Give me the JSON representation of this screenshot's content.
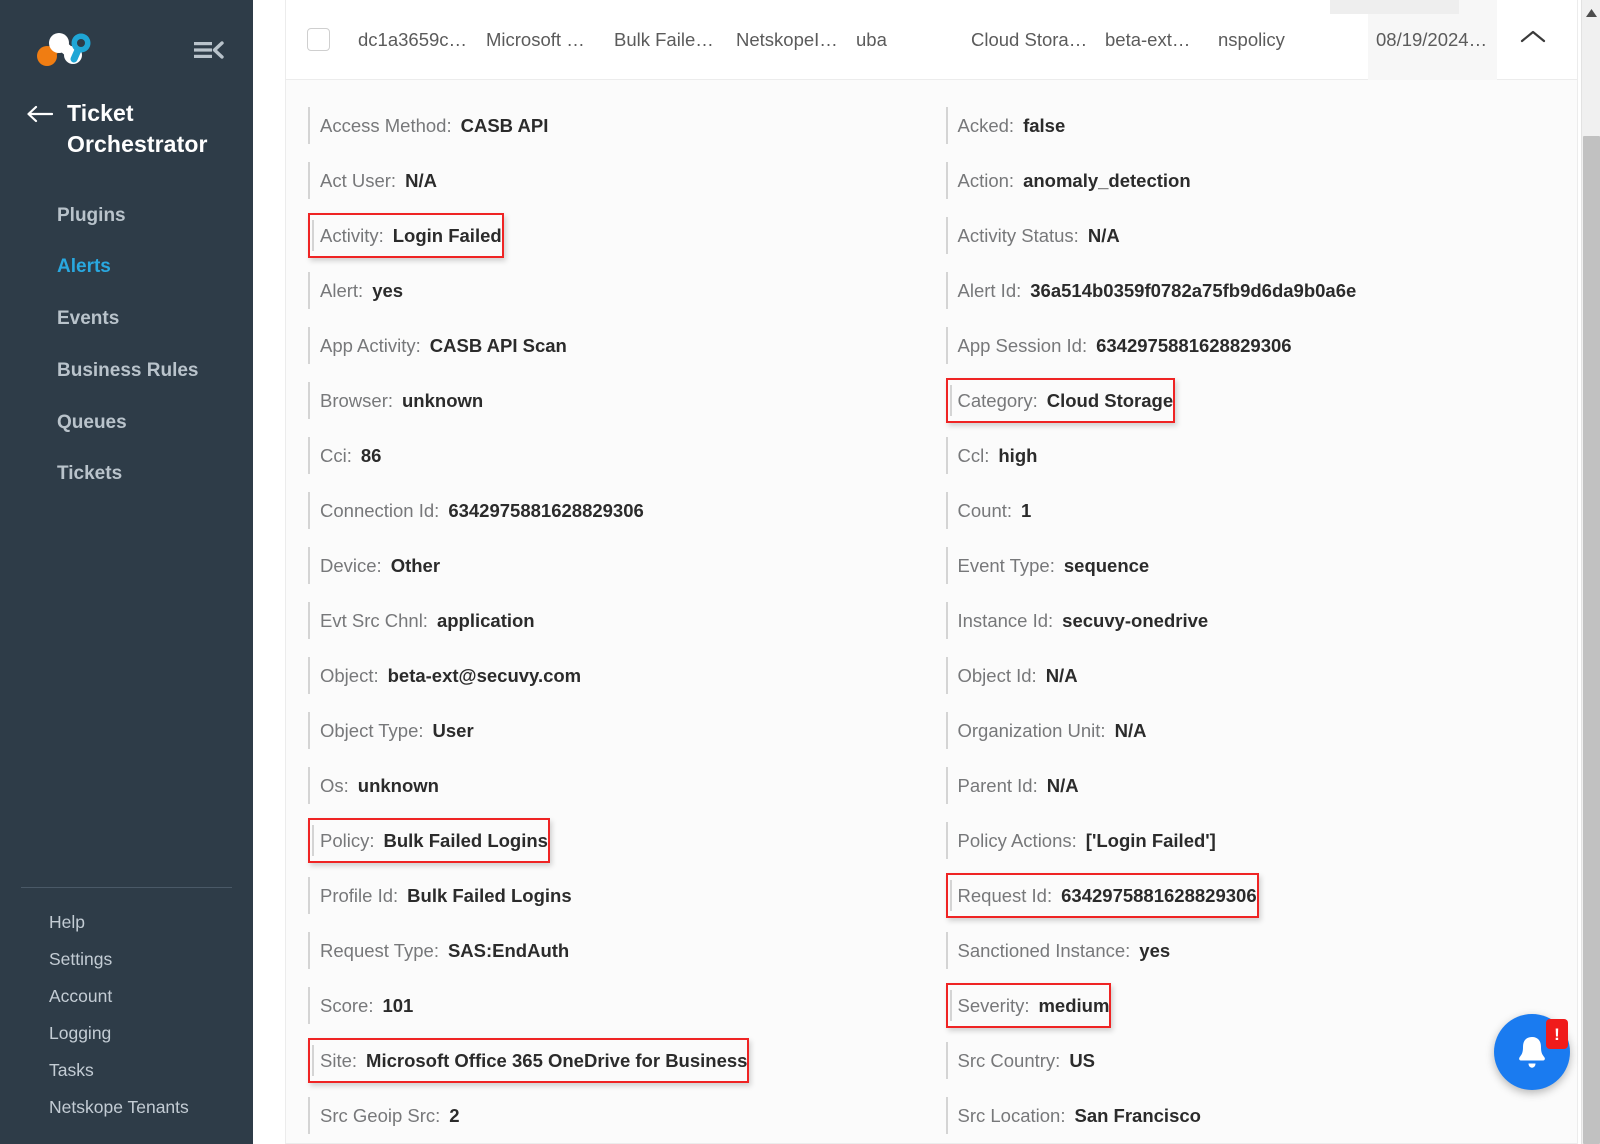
{
  "brand": {
    "logo_name": "secuvy-logo",
    "collapse_label": "collapse-sidebar"
  },
  "sidebar": {
    "title": "Ticket Orchestrator",
    "back_label": "back",
    "items": [
      {
        "label": "Plugins",
        "active": false
      },
      {
        "label": "Alerts",
        "active": true
      },
      {
        "label": "Events",
        "active": false
      },
      {
        "label": "Business Rules",
        "active": false
      },
      {
        "label": "Queues",
        "active": false
      },
      {
        "label": "Tickets",
        "active": false
      }
    ],
    "footer_items": [
      {
        "label": "Help"
      },
      {
        "label": "Settings"
      },
      {
        "label": "Account"
      },
      {
        "label": "Logging"
      },
      {
        "label": "Tasks"
      },
      {
        "label": "Netskope Tenants"
      }
    ]
  },
  "table_row": {
    "checkbox_checked": false,
    "cells": [
      {
        "text": "dc1a3659c7...",
        "sorted": false
      },
      {
        "text": "Microsoft Of...",
        "sorted": false
      },
      {
        "text": "Bulk Failed L...",
        "sorted": false
      },
      {
        "text": "NetskopeITS...",
        "sorted": false
      },
      {
        "text": "uba",
        "sorted": false
      },
      {
        "text": "Cloud Storage",
        "sorted": false
      },
      {
        "text": "beta-ext@se...",
        "sorted": false
      },
      {
        "text": "nspolicy",
        "sorted": false
      },
      {
        "text": "08/19/2024 ...",
        "sorted": true
      }
    ],
    "expand_icon": "chevron-up-icon"
  },
  "details": {
    "left": [
      {
        "label": "Access Method:",
        "value": "CASB API",
        "highlighted": false
      },
      {
        "label": "Act User:",
        "value": "N/A",
        "highlighted": false
      },
      {
        "label": "Activity:",
        "value": "Login Failed",
        "highlighted": true
      },
      {
        "label": "Alert:",
        "value": "yes",
        "highlighted": false
      },
      {
        "label": "App Activity:",
        "value": "CASB API Scan",
        "highlighted": false
      },
      {
        "label": "Browser:",
        "value": "unknown",
        "highlighted": false
      },
      {
        "label": "Cci:",
        "value": "86",
        "highlighted": false
      },
      {
        "label": "Connection Id:",
        "value": "6342975881628829306",
        "highlighted": false
      },
      {
        "label": "Device:",
        "value": "Other",
        "highlighted": false
      },
      {
        "label": "Evt Src Chnl:",
        "value": "application",
        "highlighted": false
      },
      {
        "label": "Object:",
        "value": "beta-ext@secuvy.com",
        "highlighted": false
      },
      {
        "label": "Object Type:",
        "value": "User",
        "highlighted": false
      },
      {
        "label": "Os:",
        "value": "unknown",
        "highlighted": false
      },
      {
        "label": "Policy:",
        "value": "Bulk Failed Logins",
        "highlighted": true
      },
      {
        "label": "Profile Id:",
        "value": "Bulk Failed Logins",
        "highlighted": false
      },
      {
        "label": "Request Type:",
        "value": "SAS:EndAuth",
        "highlighted": false
      },
      {
        "label": "Score:",
        "value": "101",
        "highlighted": false
      },
      {
        "label": "Site:",
        "value": "Microsoft Office 365 OneDrive for Business",
        "highlighted": true
      },
      {
        "label": "Src Geoip Src:",
        "value": "2",
        "highlighted": false
      }
    ],
    "right": [
      {
        "label": "Acked:",
        "value": "false",
        "highlighted": false
      },
      {
        "label": "Action:",
        "value": "anomaly_detection",
        "highlighted": false
      },
      {
        "label": "Activity Status:",
        "value": "N/A",
        "highlighted": false
      },
      {
        "label": "Alert Id:",
        "value": "36a514b0359f0782a75fb9d6da9b0a6e",
        "highlighted": false
      },
      {
        "label": "App Session Id:",
        "value": "6342975881628829306",
        "highlighted": false
      },
      {
        "label": "Category:",
        "value": "Cloud Storage",
        "highlighted": true
      },
      {
        "label": "Ccl:",
        "value": "high",
        "highlighted": false
      },
      {
        "label": "Count:",
        "value": "1",
        "highlighted": false
      },
      {
        "label": "Event Type:",
        "value": "sequence",
        "highlighted": false
      },
      {
        "label": "Instance Id:",
        "value": "secuvy-onedrive",
        "highlighted": false
      },
      {
        "label": "Object Id:",
        "value": "N/A",
        "highlighted": false
      },
      {
        "label": "Organization Unit:",
        "value": "N/A",
        "highlighted": false
      },
      {
        "label": "Parent Id:",
        "value": "N/A",
        "highlighted": false
      },
      {
        "label": "Policy Actions:",
        "value": "['Login Failed']",
        "highlighted": false
      },
      {
        "label": "Request Id:",
        "value": "6342975881628829306",
        "highlighted": true
      },
      {
        "label": "Sanctioned Instance:",
        "value": "yes",
        "highlighted": false
      },
      {
        "label": "Severity:",
        "value": "medium",
        "highlighted": true
      },
      {
        "label": "Src Country:",
        "value": "US",
        "highlighted": false
      },
      {
        "label": "Src Location:",
        "value": "San Francisco",
        "highlighted": false
      }
    ]
  },
  "fab": {
    "icon": "bell-icon",
    "badge": "!"
  },
  "colors": {
    "sidebar_bg": "#2e3c48",
    "accent": "#29a8e0",
    "highlight_border": "#ef2424",
    "fab_bg": "#1a7bf0",
    "badge_bg": "#f01b1b",
    "logo_orange": "#f07d12",
    "logo_blue": "#1fa6d6"
  }
}
